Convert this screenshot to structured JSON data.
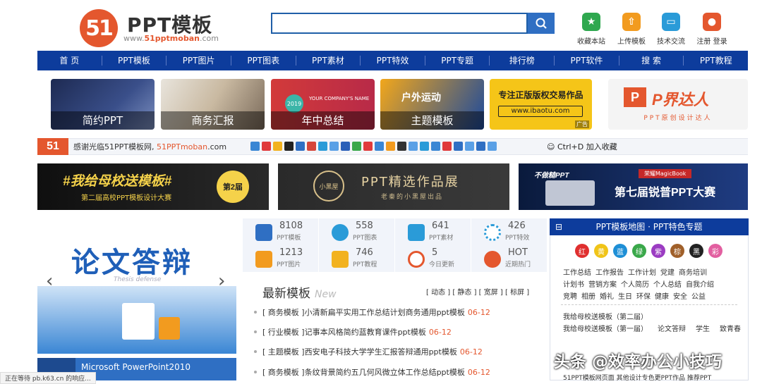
{
  "logo": {
    "mark": "51",
    "name": "PPT模板",
    "url_prefix": "www.",
    "url_brand": "51pptmoban",
    "url_suffix": ".com"
  },
  "search": {
    "placeholder": ""
  },
  "header_actions": [
    {
      "label": "收藏本站",
      "icon": "star-icon",
      "color": "#2fa84f"
    },
    {
      "label": "上传模板",
      "icon": "upload-icon",
      "color": "#f29b1f"
    },
    {
      "label": "技术交流",
      "icon": "chat-icon",
      "color": "#2a9bd8"
    },
    {
      "label": "注册 登录",
      "icon": "user-icon",
      "color": "#e4572e"
    }
  ],
  "nav": [
    "首 页",
    "PPT模板",
    "PPT图片",
    "PPT图表",
    "PPT素材",
    "PPT特效",
    "PPT专题",
    "排行榜",
    "PPT软件",
    "搜 索",
    "PPT教程"
  ],
  "tiles": [
    {
      "caption": "简约PPT"
    },
    {
      "caption": "商务汇报"
    },
    {
      "caption": "年中总结",
      "badge": "2019",
      "sub": "YOUR COMPANY'S NAME"
    },
    {
      "caption": "主题模板",
      "sub": "户外运动"
    },
    {
      "line1": "专注正版版权交易作品",
      "line2": "www.ibaotu.com",
      "ad": "广告"
    },
    {
      "brand": "P界达人",
      "sub": "PPT原创设计达人"
    }
  ],
  "ticker": {
    "mark": "51",
    "text_prefix": "感谢光临51PPT模板网, ",
    "text_link": "51PPTmoban",
    "text_suffix": ".com",
    "shortcut": "Ctrl+D 加入收藏"
  },
  "promos": [
    {
      "title": "#我给母校送模板#",
      "sub": "第二届高校PPT模板设计大赛",
      "badge": "第2届"
    },
    {
      "title": "PPT精选作品展",
      "sub": "老秦的小黑屋出品",
      "crest": "小黑屋"
    },
    {
      "tag": "荣耀MagicBook",
      "title": "第七届锐普PPT大赛",
      "mini": "不做糙PPT"
    }
  ],
  "slider": {
    "title": "论文答辩",
    "sub": "Thesis defense",
    "next_item": "Microsoft PowerPoint2010"
  },
  "stats": [
    {
      "num": "8108",
      "label": "PPT模板",
      "color": "#2f6fc3"
    },
    {
      "num": "558",
      "label": "PPT图表",
      "color": "#2a9bd8"
    },
    {
      "num": "641",
      "label": "PPT素材",
      "color": "#2a9bd8"
    },
    {
      "num": "426",
      "label": "PPT特效",
      "color": "#2a9bd8"
    },
    {
      "num": "1213",
      "label": "PPT图片",
      "color": "#f29b1f"
    },
    {
      "num": "746",
      "label": "PPT教程",
      "color": "#f2b21f"
    },
    {
      "num": "5",
      "label": "今日更新",
      "color": "#e4572e"
    },
    {
      "num": "HOT",
      "label": "近期热门",
      "color": "#e4572e"
    }
  ],
  "latest": {
    "title": "最新模板",
    "title_en": "New",
    "tabs": "[ 动态 ] [ 静态 ] [ 宽屏 ] [ 标屏 ]",
    "rows": [
      {
        "cat": "[ 商务模板 ]",
        "title": "小清新扁平实用工作总结计划商务通用ppt模板",
        "date": "06-12"
      },
      {
        "cat": "[ 行业模板 ]",
        "title": "记事本风格简约蓝教育课件ppt模板",
        "date": "06-12"
      },
      {
        "cat": "[ 主题模板 ]",
        "title": "西安电子科技大学学生汇报答辩通用ppt模板",
        "date": "06-12"
      },
      {
        "cat": "[ 商务模板 ]",
        "title": "条纹背景简约五几何风微立体工作总结ppt模板",
        "date": "06-12"
      }
    ]
  },
  "sidebar": {
    "title": "PPT模板地图 · PPT特色专题",
    "colors": [
      {
        "label": "红",
        "hex": "#e02f2f"
      },
      {
        "label": "黄",
        "hex": "#f0c418"
      },
      {
        "label": "蓝",
        "hex": "#1e8fd6"
      },
      {
        "label": "绿",
        "hex": "#3aa84a"
      },
      {
        "label": "紫",
        "hex": "#9b3cc2"
      },
      {
        "label": "棕",
        "hex": "#a0602a"
      },
      {
        "label": "黑",
        "hex": "#222222"
      },
      {
        "label": "彩",
        "hex": "#e25fa0"
      }
    ],
    "tag_rows": [
      [
        "工作总结",
        "工作报告",
        "工作计划",
        "党建",
        "商务培训"
      ],
      [
        "计划书",
        "营销方案",
        "个人简历",
        "个人总结",
        "自我介绍"
      ],
      [
        "竞聘",
        "相册",
        "婚礼",
        "生日",
        "环保",
        "健康",
        "安全",
        "公益"
      ]
    ],
    "links": [
      [
        "我给母校送模板（第二届）"
      ],
      [
        "我给母校送模板（第一届）",
        "论文答辩",
        "学生",
        "致青春"
      ]
    ],
    "bottom": "51PPT模板网页面   其他设计专色更PPT作品   推荐PPT"
  },
  "status": "正在等待 pb.k63.cn 的响应...",
  "watermark": "头条 @效率办公小技巧"
}
